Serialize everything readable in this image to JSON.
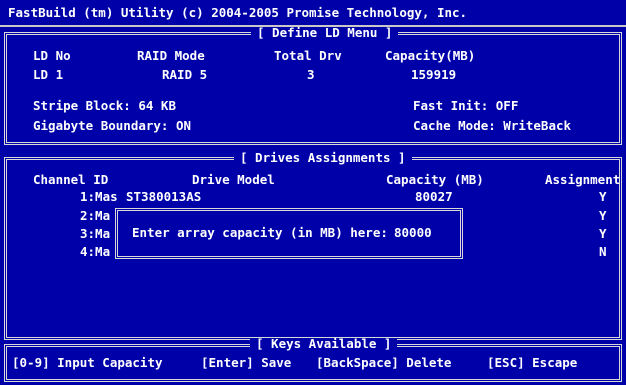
{
  "title": "FastBuild (tm) Utility (c) 2004-2005 Promise Technology, Inc.",
  "define_ld": {
    "legend": "[ Define LD Menu ]",
    "headers": {
      "ld_no": "LD No",
      "raid_mode": "RAID Mode",
      "total_drv": "Total Drv",
      "capacity": "Capacity(MB)"
    },
    "row": {
      "ld_no": "LD 1",
      "raid_mode": "RAID 5",
      "total_drv": "3",
      "capacity": "159919"
    },
    "stripe_block": "Stripe Block: 64 KB",
    "fast_init": "Fast Init: OFF",
    "gigabyte_boundary": "Gigabyte Boundary: ON",
    "cache_mode": "Cache Mode: WriteBack"
  },
  "drives": {
    "legend": "[ Drives Assignments ]",
    "headers": {
      "channel_id": "Channel ID",
      "drive_model": "Drive Model",
      "capacity": "Capacity (MB)",
      "assignment": "Assignment"
    },
    "rows": [
      {
        "channel": "1:Mas",
        "model": "ST380013AS",
        "capacity": "80027",
        "assignment": "Y"
      },
      {
        "channel": "2:Ma",
        "model": "",
        "capacity": "",
        "assignment": "Y"
      },
      {
        "channel": "3:Ma",
        "model": "",
        "capacity": "",
        "assignment": "Y"
      },
      {
        "channel": "4:Ma",
        "model": "",
        "capacity": "",
        "assignment": "N"
      }
    ]
  },
  "dialog": {
    "prompt": "Enter array capacity (in MB) here:",
    "value": "80000"
  },
  "keys": {
    "legend": "[ Keys Available ]",
    "input_capacity": "[0-9] Input Capacity",
    "save": "[Enter] Save",
    "delete": "[BackSpace] Delete",
    "escape": "[ESC] Escape"
  },
  "colors": {
    "background": "#0000a8",
    "text": "#ffffff",
    "border": "#d8d8d8"
  }
}
